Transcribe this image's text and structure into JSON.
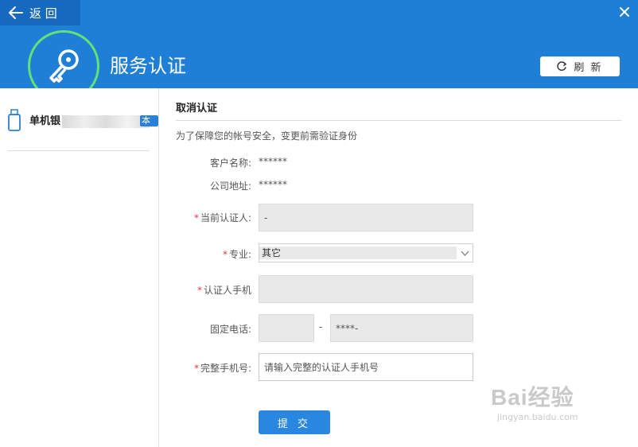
{
  "header": {
    "back_label": "返 回",
    "title": "服务认证",
    "refresh_label": "刷 新"
  },
  "sidebar": {
    "device_name": "单机银",
    "badge": "本机"
  },
  "form": {
    "section_title": "取消认证",
    "notice": "为了保障您的帐号安全，变更前需验证身份",
    "customer_name_label": "客户名称:",
    "customer_name_value": "******",
    "company_address_label": "公司地址:",
    "company_address_value": "******",
    "certifier_label": "当前认证人:",
    "certifier_value": "-",
    "major_label": "专业:",
    "major_value": "其它",
    "phone_label": "认证人手机",
    "landline_label": "固定电话:",
    "landline_separator": "-",
    "landline_value": "****-",
    "full_phone_label": "完整手机号:",
    "full_phone_placeholder": "请输入完整的认证人手机号",
    "submit_label": "提 交"
  },
  "watermark": {
    "main": "Bai经验",
    "sub": "jingyan.baidu.com"
  },
  "colors": {
    "header_blue": "#1f7fd6",
    "back_blue": "#1769bf",
    "accent_green": "#60e27a",
    "required_red": "#e23a3a",
    "button_blue": "#2a87e0"
  }
}
